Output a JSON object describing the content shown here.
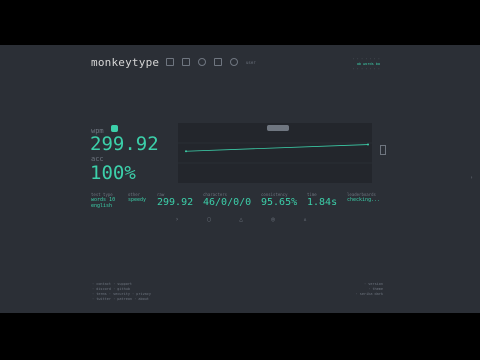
{
  "app": {
    "logo": "monkeytype",
    "user": "user"
  },
  "header_right": {
    "line1": "· · · · · · ·",
    "line2": "ab words ba",
    "line3": "· · · · · · ·"
  },
  "results": {
    "wpm_label": "wpm",
    "wpm_value": "299.92",
    "acc_label": "acc",
    "acc_value": "100%"
  },
  "stats": {
    "test_type_label": "test type",
    "test_type_value1": "words 10",
    "test_type_value2": "english",
    "other_label": "other",
    "other_value": "speedy",
    "raw_label": "raw",
    "raw_value": "299.92",
    "characters_label": "characters",
    "characters_value": "46/0/0/0",
    "consistency_label": "consistency",
    "consistency_value": "95.65%",
    "time_label": "time",
    "time_value": "1.84s",
    "leaderboards_label": "leaderboards",
    "leaderboards_value": "checking..."
  },
  "actions": [
    "›",
    "▢",
    "△",
    "◎",
    "▵"
  ],
  "footer_left": [
    "· contact · support",
    "· discord · github",
    "· terms · security · privacy",
    "· twitter · patreon · about"
  ],
  "footer_right": [
    "· version",
    "· theme",
    "· serika dark"
  ],
  "colors": {
    "accent": "#3cd0aa",
    "bg": "#2b2f36",
    "sub": "#6f7680",
    "text": "#d6d6d6",
    "plot": "#23262c"
  },
  "chart_data": {
    "type": "line",
    "x": [
      1,
      2
    ],
    "series": [
      {
        "values": [
          300,
          312
        ]
      }
    ]
  }
}
